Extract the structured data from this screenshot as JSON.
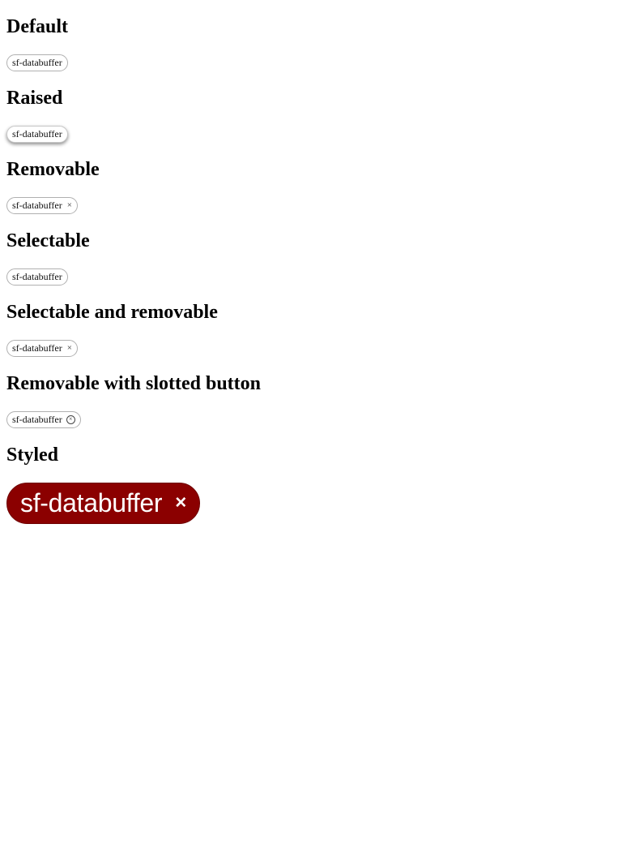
{
  "sections": [
    {
      "heading": "Default",
      "chip_label": "sf-databuffer"
    },
    {
      "heading": "Raised",
      "chip_label": "sf-databuffer"
    },
    {
      "heading": "Removable",
      "chip_label": "sf-databuffer",
      "remove_glyph": "×"
    },
    {
      "heading": "Selectable",
      "chip_label": "sf-databuffer"
    },
    {
      "heading": "Selectable and removable",
      "chip_label": "sf-databuffer",
      "remove_glyph": "×"
    },
    {
      "heading": "Removable with slotted button",
      "chip_label": "sf-databuffer",
      "remove_glyph": "×"
    },
    {
      "heading": "Styled",
      "chip_label": "sf-databuffer",
      "remove_glyph": "×"
    }
  ],
  "icons": {
    "remove": "close-icon",
    "slotted_remove": "circled-x-icon"
  },
  "colors": {
    "styled_chip_background": "#8b0000",
    "styled_chip_text": "#ffffff",
    "chip_border": "#b0b0b0"
  }
}
